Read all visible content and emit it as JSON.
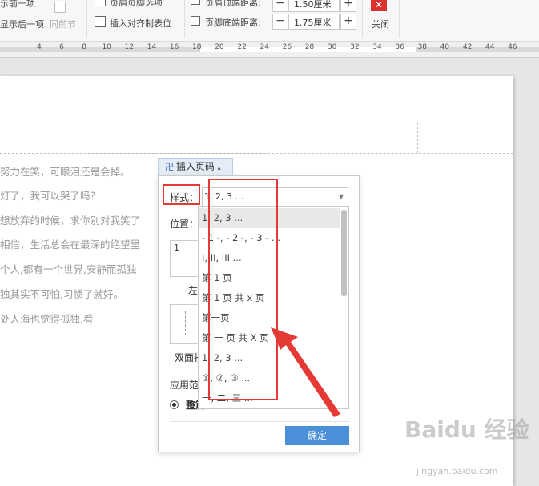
{
  "toolbar": {
    "show_prev": "示前一项",
    "show_next": "显示后一项",
    "same_section": "同前节",
    "header_footer_options": "页眉页脚选项",
    "insert_align_tab": "插入对齐制表位",
    "header_top_label": "页眉顶端距离:",
    "header_top_value": "1.50厘米",
    "footer_bottom_label": "页脚底端距离:",
    "footer_bottom_value": "1.75厘米",
    "close_label": "关闭"
  },
  "ruler": {
    "numbers": [
      "4",
      "6",
      "8",
      "10",
      "12",
      "14",
      "16",
      "18",
      "20",
      "22",
      "24",
      "26",
      "28",
      "30",
      "32",
      "34",
      "36",
      "38",
      "40",
      "42",
      "44",
      "46"
    ]
  },
  "document": {
    "lines": [
      "努力在笑，可眼泪还是会掉。",
      "灯了，我可以哭了吗？",
      "想放弃的时候，求你别对我笑了",
      "相信，生活总会在最深的绝望里",
      "个人,都有一个世界,安静而孤独",
      "独其实不可怕,习惯了就好。",
      "处人海也觉得孤独,看"
    ]
  },
  "insert_button": {
    "label": "插入页码",
    "caret": "▴"
  },
  "dialog": {
    "style_label": "样式：",
    "style_value": "1, 2, 3 ...",
    "position_label": "位置：",
    "pos_box_number": "1",
    "pos_left_label": "左",
    "double_sided_label": "双面打",
    "apply_label": "应用范",
    "whole_label": "整篇",
    "ok_label": "确定"
  },
  "dropdown": {
    "items": [
      "1, 2, 3 ...",
      "- 1 -, - 2 -, - 3 - ...",
      "I, II, III ...",
      "第 1 页",
      "第 1 页 共 x 页",
      "第一页",
      "第 一 页 共 X 页",
      "1, 2, 3 ...",
      "①, ②, ③ ...",
      "一, 二, 三 ..."
    ],
    "selected_index": 0
  },
  "watermark": {
    "brand": "Baidu 经验",
    "url": "jingyan.baidu.com"
  },
  "colors": {
    "accent": "#4a8fd8",
    "annotation": "#e53935",
    "close": "#d9322f"
  }
}
